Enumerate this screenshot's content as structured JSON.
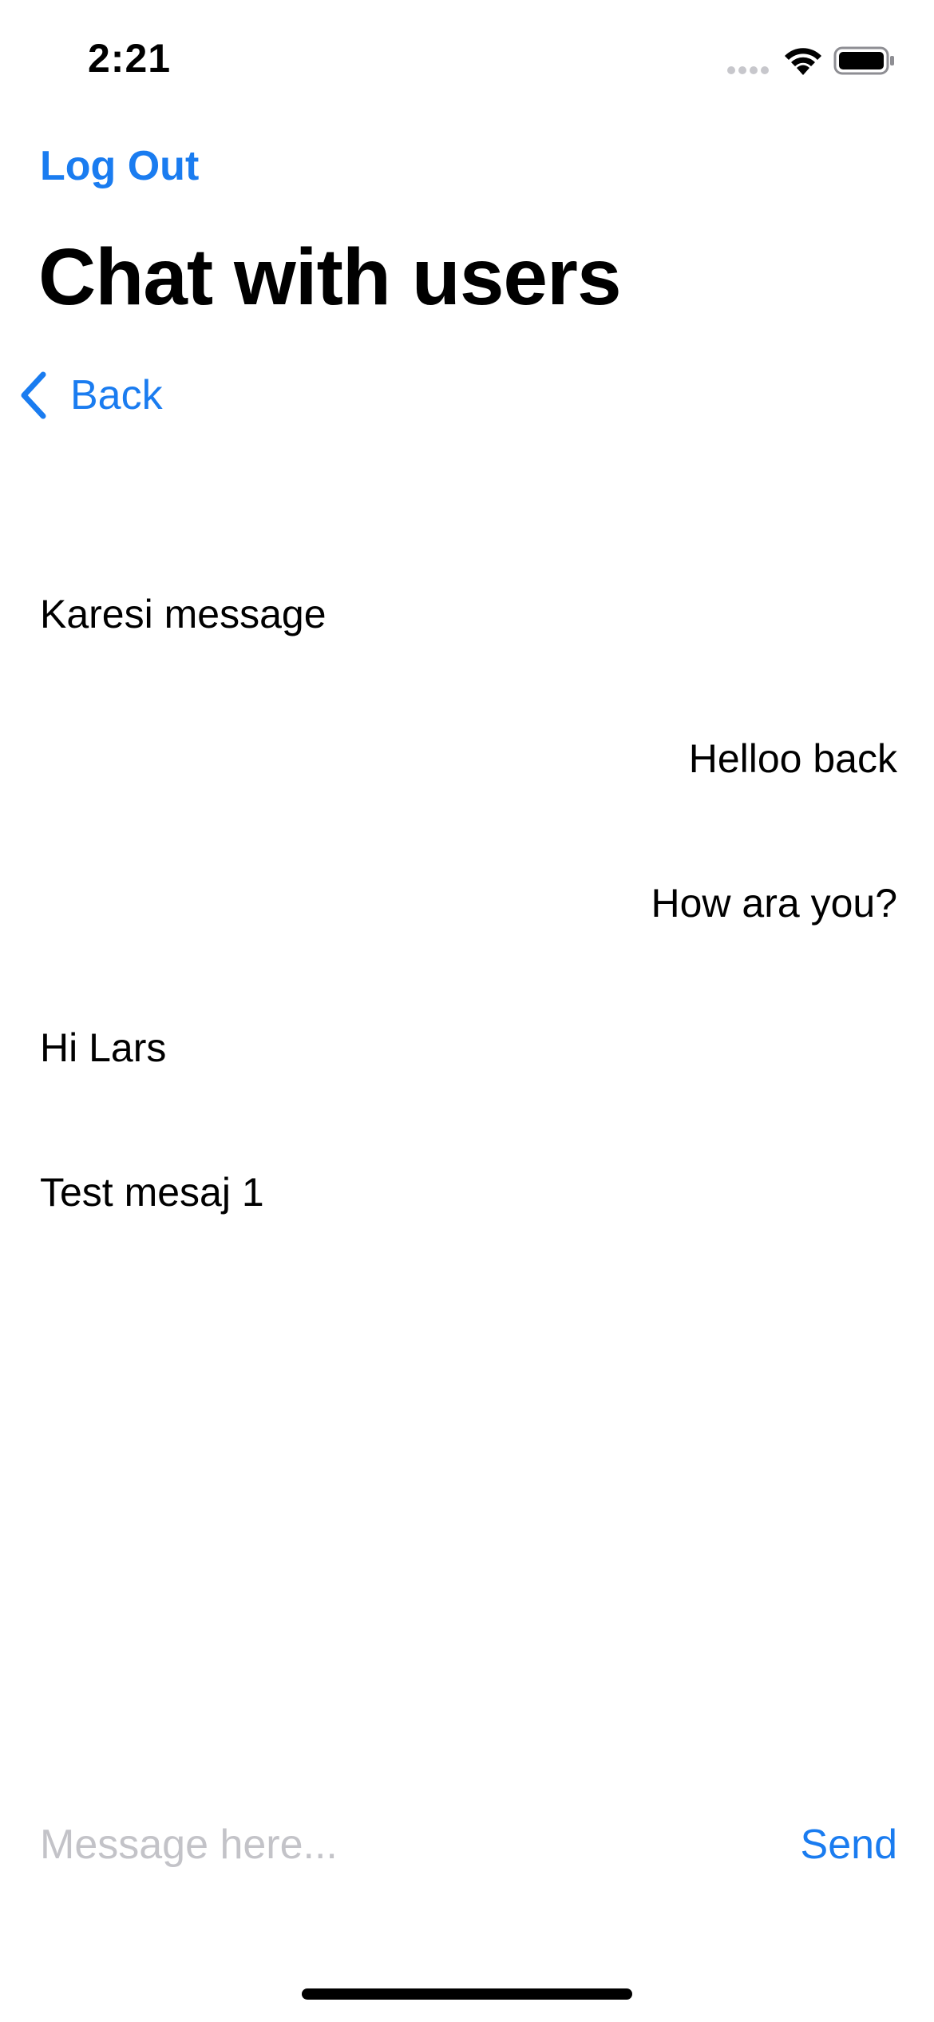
{
  "status_bar": {
    "time": "2:21",
    "icons": [
      "signal-dots-icon",
      "wifi-icon",
      "battery-icon"
    ]
  },
  "nav": {
    "logout_label": "Log Out",
    "title": "Chat with users",
    "back_label": "Back"
  },
  "messages": [
    {
      "text": "Karesi message",
      "align": "incoming"
    },
    {
      "text": "Helloo back",
      "align": "outgoing"
    },
    {
      "text": "How ara you?",
      "align": "outgoing"
    },
    {
      "text": "Hi Lars",
      "align": "incoming"
    },
    {
      "text": "Test mesaj 1",
      "align": "incoming"
    }
  ],
  "composer": {
    "placeholder": "Message here...",
    "value": "",
    "send_label": "Send"
  },
  "colors": {
    "accent": "#1a7cf0",
    "placeholder": "#c3c3c8",
    "text": "#000000",
    "background": "#ffffff"
  }
}
